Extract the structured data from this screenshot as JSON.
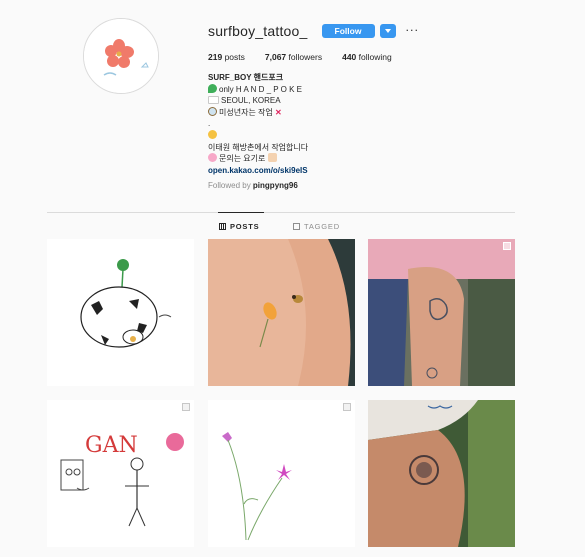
{
  "profile": {
    "username": "surfboy_tattoo_",
    "follow_label": "Follow",
    "dropdown_icon": "chevron-down-icon",
    "more_label": "···"
  },
  "stats": {
    "posts_count": "219",
    "posts_label": "posts",
    "followers_count": "7,067",
    "followers_label": "followers",
    "following_count": "440",
    "following_label": "following"
  },
  "bio": {
    "name": "SURF_BOY 핸드포크",
    "line1": "only H A N D _ P O K E",
    "line2": "SEOUL, KOREA",
    "line3": "미성년자는 작업",
    "line4": ".",
    "line5": "",
    "line6": "이태원 해방촌에서 작업합니다",
    "line7": "문의는 요기로",
    "link": "open.kakao.com/o/ski9eIS",
    "followed_by_prefix": "Followed by",
    "followed_by_user": "pingpyng96"
  },
  "tabs": {
    "posts": "POSTS",
    "tagged": "TAGGED"
  },
  "colors": {
    "accent": "#3897f0",
    "link": "#003569",
    "muted": "#8e8e8e",
    "text": "#262626"
  },
  "icons": {
    "bio_line1": "green-heart-icon",
    "bio_line2": "korea-flag-icon",
    "bio_line3": "magnifier-icon",
    "bio_line3_end": "cross-mark-icon",
    "bio_line5": "smiley-icon",
    "bio_line7": "cherry-blossom-icon",
    "bio_line7_end": "pointing-hand-icon"
  }
}
